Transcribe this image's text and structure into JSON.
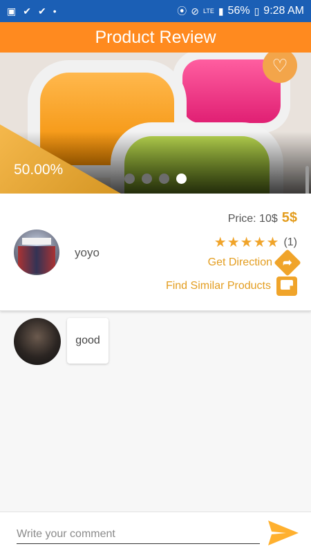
{
  "status_bar": {
    "battery": "56%",
    "time": "9:28 AM",
    "network": "LTE"
  },
  "app_bar": {
    "title": "Product Review"
  },
  "hero": {
    "discount": "50.00%",
    "slides": 4,
    "active_slide": 4
  },
  "shop": {
    "name": "yoyo"
  },
  "product": {
    "price_old": "Price: 10$",
    "price_new": "5$",
    "stars": "★★★★★",
    "rating_count": "(1)",
    "direction_label": "Get Direction",
    "similar_label": "Find Similar Products"
  },
  "comments": [
    {
      "text": "good"
    }
  ],
  "composer": {
    "placeholder": "Write your comment"
  },
  "colors": {
    "accent": "#ff8a1f",
    "status_bar": "#1b5fb5",
    "gold": "#e39d1f"
  },
  "icons": [
    "gallery-icon",
    "check-icon",
    "location-icon",
    "mute-icon",
    "signal-icon",
    "battery-icon",
    "heart-icon",
    "direction-icon",
    "similar-products-icon",
    "send-icon"
  ]
}
